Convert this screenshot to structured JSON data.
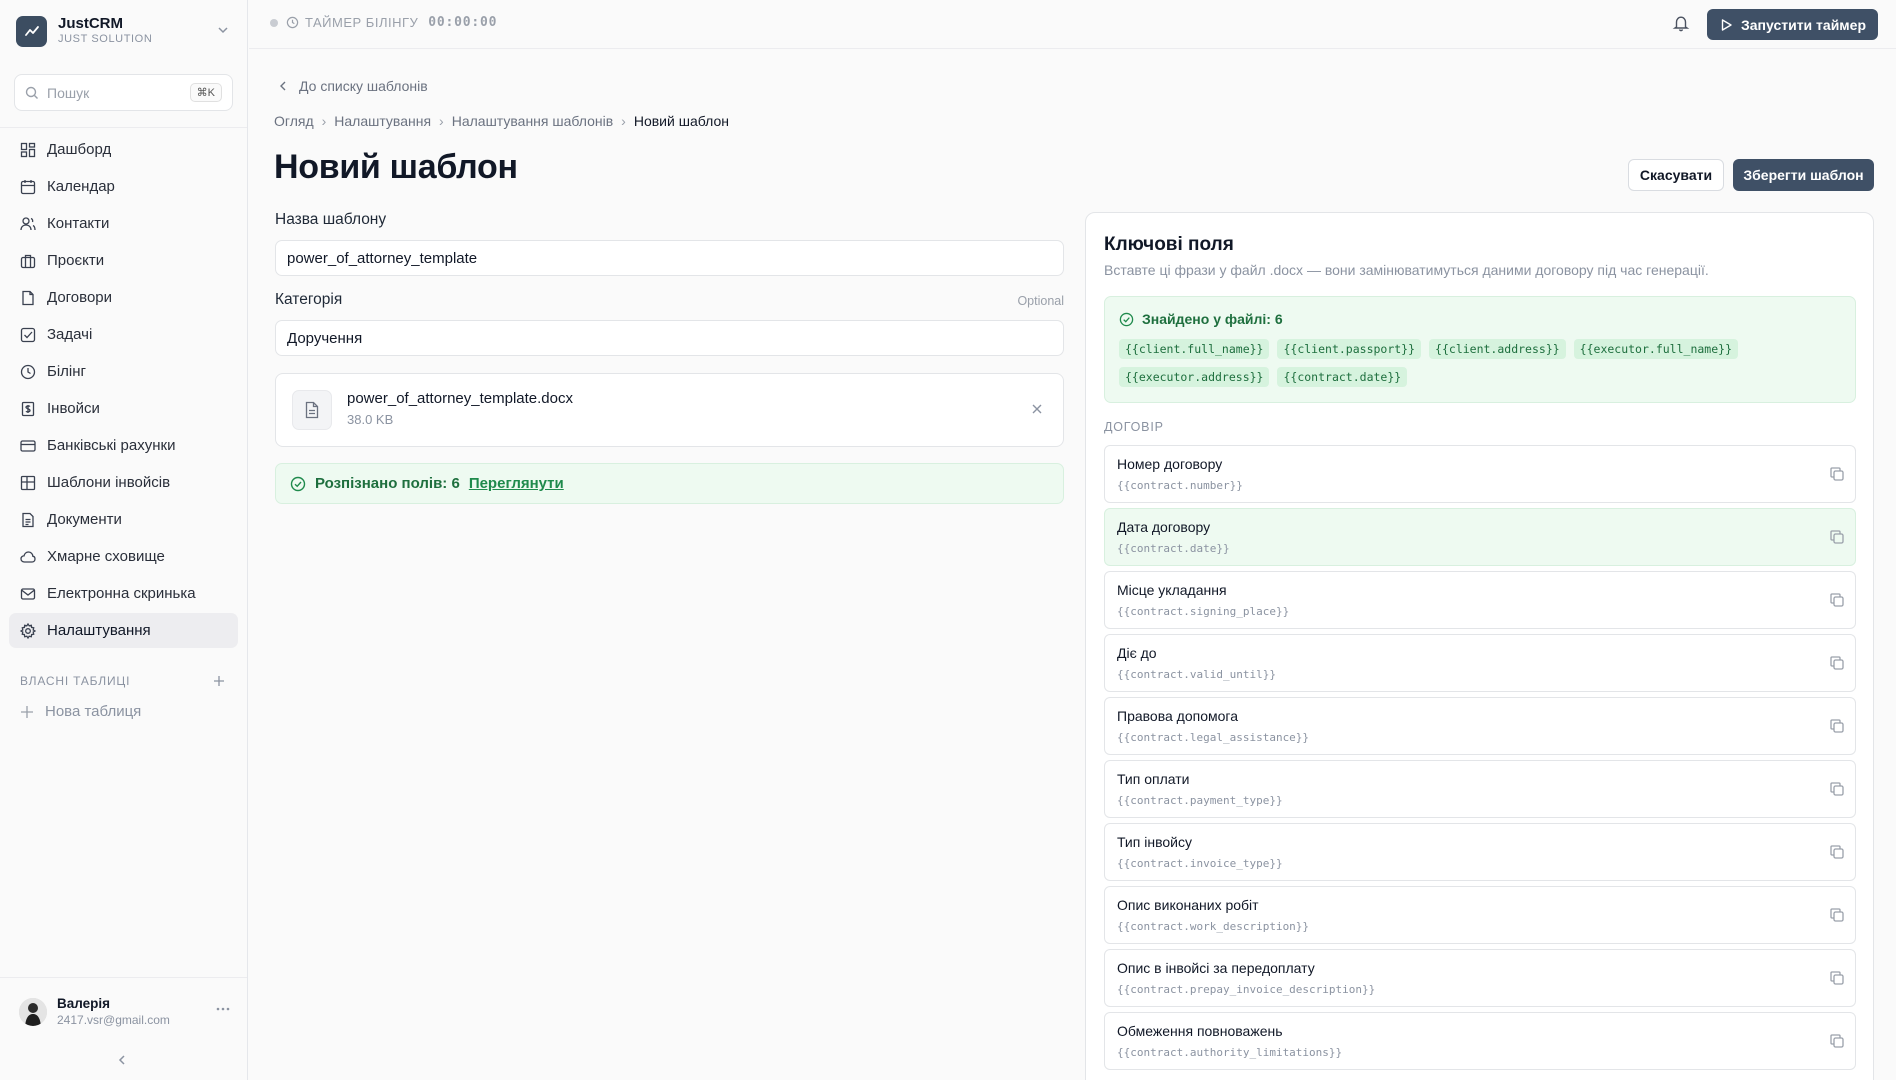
{
  "app": {
    "name": "JustCRM",
    "subtitle": "JUST SOLUTION"
  },
  "search": {
    "placeholder": "Пошук",
    "shortcut": "⌘K"
  },
  "nav": {
    "items": [
      {
        "label": "Дашборд",
        "icon": "dashboard-icon"
      },
      {
        "label": "Календар",
        "icon": "calendar-icon"
      },
      {
        "label": "Контакти",
        "icon": "users-icon"
      },
      {
        "label": "Проєкти",
        "icon": "briefcase-icon"
      },
      {
        "label": "Договори",
        "icon": "document-icon"
      },
      {
        "label": "Задачі",
        "icon": "checkbox-icon"
      },
      {
        "label": "Білінг",
        "icon": "clock-icon"
      },
      {
        "label": "Інвойси",
        "icon": "invoice-icon"
      },
      {
        "label": "Банківські рахунки",
        "icon": "credit-card-icon"
      },
      {
        "label": "Шаблони інвойсів",
        "icon": "grid-icon"
      },
      {
        "label": "Документи",
        "icon": "file-text-icon"
      },
      {
        "label": "Хмарне сховище",
        "icon": "cloud-icon"
      },
      {
        "label": "Електронна скринька",
        "icon": "mail-icon"
      },
      {
        "label": "Налаштування",
        "icon": "gear-icon",
        "active": true
      }
    ],
    "custom_tables_label": "ВЛАСНІ ТАБЛИЦІ",
    "new_table_label": "Нова таблиця"
  },
  "user": {
    "name": "Валерія",
    "email": "2417.vsr@gmail.com"
  },
  "topbar": {
    "timer_label": "ТАЙМЕР БІЛІНГУ",
    "timer_value": "00:00:00",
    "start_timer_label": "Запустити таймер"
  },
  "page": {
    "back_label": "До списку шаблонів",
    "breadcrumb": [
      "Огляд",
      "Налаштування",
      "Налаштування шаблонів",
      "Новий шаблон"
    ],
    "title": "Новий шаблон",
    "cancel_label": "Скасувати",
    "save_label": "Зберегти шаблон"
  },
  "form": {
    "name_label": "Назва шаблону",
    "name_value": "power_of_attorney_template",
    "category_label": "Категорія",
    "category_optional": "Optional",
    "category_value": "Доручення",
    "file": {
      "name": "power_of_attorney_template.docx",
      "size": "38.0 KB"
    },
    "recognized_text": "Розпізнано полів: 6",
    "recognized_link": "Переглянути"
  },
  "key_fields": {
    "title": "Ключові поля",
    "subtitle": "Вставте ці фрази у файл .docx — вони замінюватимуться даними договору під час генерації.",
    "found_label": "Знайдено у файлі: 6",
    "found_chips": [
      "{{client.full_name}}",
      "{{client.passport}}",
      "{{client.address}}",
      "{{executor.full_name}}",
      "{{executor.address}}",
      "{{contract.date}}"
    ],
    "group_label": "ДОГОВІР",
    "fields": [
      {
        "label": "Номер договору",
        "key": "{{contract.number}}",
        "highlighted": false
      },
      {
        "label": "Дата договору",
        "key": "{{contract.date}}",
        "highlighted": true
      },
      {
        "label": "Місце укладання",
        "key": "{{contract.signing_place}}",
        "highlighted": false
      },
      {
        "label": "Діє до",
        "key": "{{contract.valid_until}}",
        "highlighted": false
      },
      {
        "label": "Правова допомога",
        "key": "{{contract.legal_assistance}}",
        "highlighted": false
      },
      {
        "label": "Тип оплати",
        "key": "{{contract.payment_type}}",
        "highlighted": false
      },
      {
        "label": "Тип інвойсу",
        "key": "{{contract.invoice_type}}",
        "highlighted": false
      },
      {
        "label": "Опис виконаних робіт",
        "key": "{{contract.work_description}}",
        "highlighted": false
      },
      {
        "label": "Опис в інвойсі за передоплату",
        "key": "{{contract.prepay_invoice_description}}",
        "highlighted": false
      },
      {
        "label": "Обмеження повноважень",
        "key": "{{contract.authority_limitations}}",
        "highlighted": false
      }
    ]
  },
  "colors": {
    "accent": "#3f5066",
    "success_bg": "#eefaf1",
    "success_text": "#1e6f3e"
  }
}
